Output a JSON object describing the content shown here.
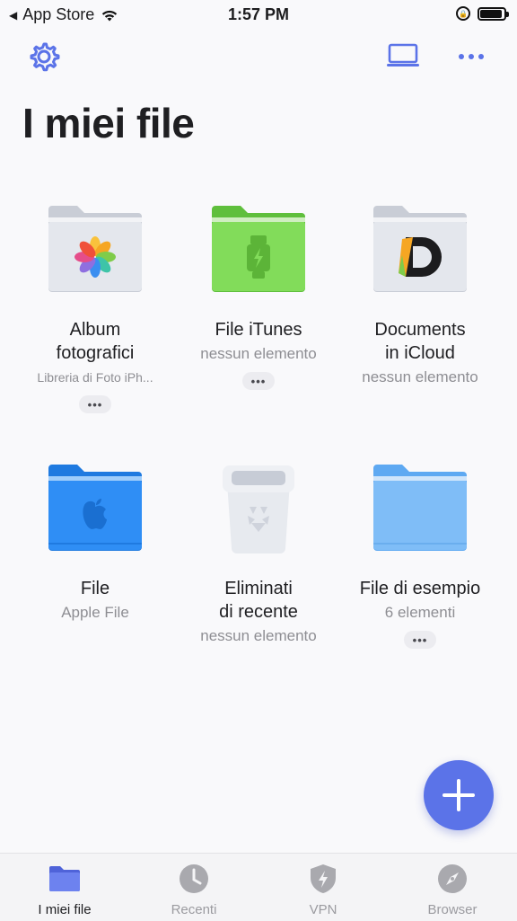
{
  "status_bar": {
    "back_app": "App Store",
    "time": "1:57 PM"
  },
  "page": {
    "title": "I miei file"
  },
  "tiles": [
    {
      "name_line1": "Album",
      "name_line2": "fotografici",
      "subtitle": "Libreria di Foto iPh..."
    },
    {
      "name_line1": "File iTunes",
      "name_line2": "",
      "subtitle": "nessun elemento"
    },
    {
      "name_line1": "Documents",
      "name_line2": "in iCloud",
      "subtitle": "nessun elemento"
    },
    {
      "name_line1": "File",
      "name_line2": "",
      "subtitle": "Apple File"
    },
    {
      "name_line1": "Eliminati",
      "name_line2": "di recente",
      "subtitle": "nessun elemento"
    },
    {
      "name_line1": "File di esempio",
      "name_line2": "",
      "subtitle": "6 elementi"
    }
  ],
  "more_label": "•••",
  "tabbar": {
    "tabs": [
      {
        "label": "I miei file",
        "icon": "folder-icon",
        "active": true
      },
      {
        "label": "Recenti",
        "icon": "clock-icon"
      },
      {
        "label": "VPN",
        "icon": "shield-icon"
      },
      {
        "label": "Browser",
        "icon": "compass-icon"
      }
    ]
  },
  "colors": {
    "accent": "#5b73e8",
    "folder_gray": "#d9dde6",
    "folder_green": "#7ed957",
    "folder_blue": "#2f8ef5",
    "folder_light_blue": "#7fbdf7"
  }
}
